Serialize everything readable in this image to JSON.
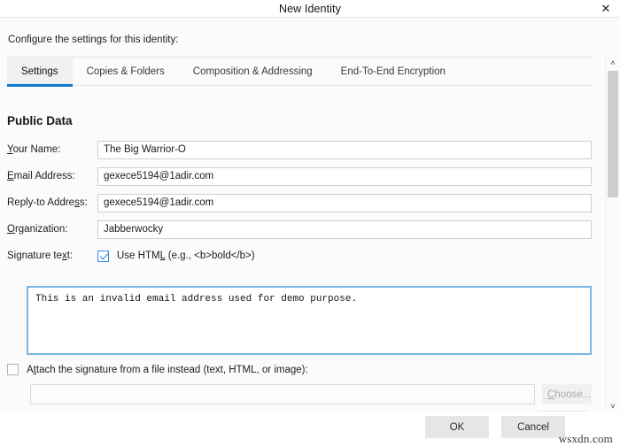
{
  "window": {
    "title": "New Identity",
    "close_icon": "close-icon",
    "close_glyph": "✕"
  },
  "intro": {
    "text": "Configure the settings for this identity:"
  },
  "tabs": [
    {
      "label": "Settings",
      "active": true
    },
    {
      "label": "Copies & Folders",
      "active": false
    },
    {
      "label": "Composition & Addressing",
      "active": false
    },
    {
      "label": "End-To-End Encryption",
      "active": false
    }
  ],
  "section": {
    "title": "Public Data"
  },
  "fields": [
    {
      "label_pre": "",
      "label_mnemonic": "Y",
      "label_post": "our Name:",
      "value": "The Big Warrior-O",
      "name": "your-name"
    },
    {
      "label_pre": "",
      "label_mnemonic": "E",
      "label_post": "mail Address:",
      "value": "gexece5194@1adir.com",
      "name": "email-address"
    },
    {
      "label_pre": "Reply-to Addre",
      "label_mnemonic": "s",
      "label_post": "s:",
      "value": "gexece5194@1adir.com",
      "name": "reply-to-address"
    },
    {
      "label_pre": "",
      "label_mnemonic": "O",
      "label_post": "rganization:",
      "value": "Jabberwocky",
      "name": "organization"
    }
  ],
  "signature": {
    "label_pre": "Signature te",
    "label_mnemonic": "x",
    "label_post": "t:",
    "use_html_pre": "Use HTM",
    "use_html_mnemonic": "L",
    "use_html_post": " (e.g., <b>bold</b>)",
    "use_html_checked": true,
    "text": "This is an invalid email address used for demo purpose."
  },
  "attach": {
    "label_pre": "A",
    "label_mnemonic": "t",
    "label_post": "tach the signature from a file instead (text, HTML, or image):",
    "checked": false,
    "file_value": "",
    "file_placeholder": "",
    "choose_pre": "",
    "choose_mnemonic": "C",
    "choose_post": "hoose..."
  },
  "scrollbar": {
    "up_arrow": "˄",
    "down_arrow": "˅"
  },
  "footer": {
    "ok_label": "OK",
    "cancel_label": "Cancel"
  },
  "watermark": {
    "text": "wsxdn.com"
  },
  "colors": {
    "accent": "#0b78d0",
    "focus_border": "#7bb6e3",
    "check": "#2a7fd4"
  }
}
